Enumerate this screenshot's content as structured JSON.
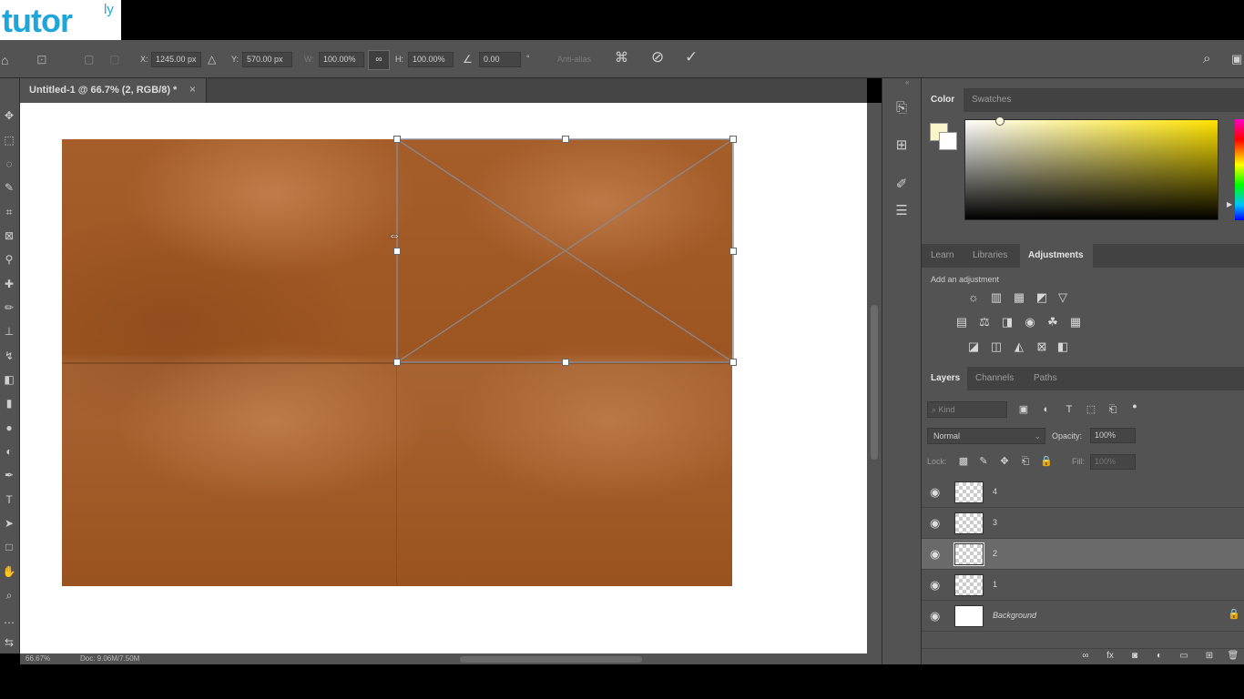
{
  "logo": {
    "text": "tutor",
    "sup": "ly"
  },
  "options_bar": {
    "x_label": "X:",
    "x_value": "1245.00 px",
    "y_label": "Y:",
    "y_value": "570.00 px",
    "w_label": "W:",
    "w_value": "100.00%",
    "h_label": "H:",
    "h_value": "100.00%",
    "angle_value": "0.00",
    "angle_unit": "°",
    "anti_alias": "Anti-alias"
  },
  "document": {
    "tab_label": "Untitled-1 @ 66.7% (2, RGB/8) *",
    "zoom": "66.67%",
    "doc_info": "Doc: 9.06M/7.50M"
  },
  "color_panel": {
    "tabs": [
      "Color",
      "Swatches"
    ],
    "active_tab": "Color",
    "foreground": "#fbf5cc",
    "background": "#ffffff"
  },
  "adjustments_panel": {
    "tabs": [
      "Learn",
      "Libraries",
      "Adjustments"
    ],
    "active_tab": "Adjustments",
    "heading": "Add an adjustment"
  },
  "layers_panel": {
    "tabs": [
      "Layers",
      "Channels",
      "Paths"
    ],
    "active_tab": "Layers",
    "filter_placeholder": "Kind",
    "blend_mode": "Normal",
    "opacity_label": "Opacity:",
    "opacity_value": "100%",
    "lock_label": "Lock:",
    "fill_label": "Fill:",
    "fill_value": "100%",
    "layers": [
      {
        "name": "4"
      },
      {
        "name": "3"
      },
      {
        "name": "2",
        "selected": true
      },
      {
        "name": "1"
      },
      {
        "name": "Background",
        "locked": true
      }
    ]
  },
  "colors": {
    "leather": "#9d5521",
    "panel": "#535353",
    "logo_blue": "#1ea6d8"
  }
}
